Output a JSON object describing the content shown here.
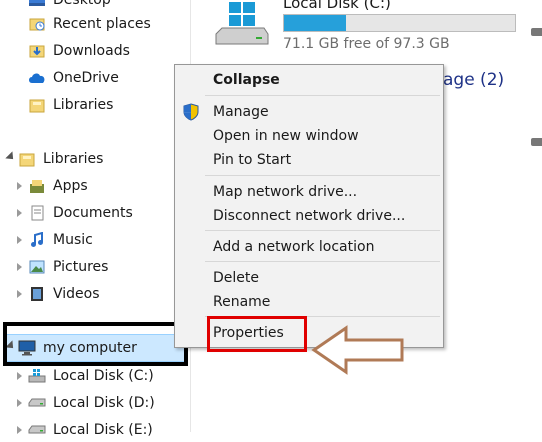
{
  "nav": {
    "quick_access": [
      "Desktop",
      "Recent places",
      "Downloads",
      "OneDrive",
      "Libraries"
    ],
    "libraries_label": "Libraries",
    "libraries": [
      "Apps",
      "Documents",
      "Music",
      "Pictures",
      "Videos"
    ],
    "computer_label": "my computer",
    "drives": [
      "Local Disk (C:)",
      "Local Disk (D:)",
      "Local Disk (E:)"
    ]
  },
  "content": {
    "disk_title": "Local Disk (C:)",
    "disk_free": "71.1 GB free of 97.3 GB",
    "disk_used_fraction": 0.27,
    "group_label": "rage (2)"
  },
  "context_menu": {
    "collapse": "Collapse",
    "manage": "Manage",
    "open_new_window": "Open in new window",
    "pin_to_start": "Pin to Start",
    "map_network_drive": "Map network drive...",
    "disconnect_network_drive": "Disconnect network drive...",
    "add_network_location": "Add a network location",
    "delete": "Delete",
    "rename": "Rename",
    "properties": "Properties"
  },
  "colors": {
    "selection": "#cce8ff",
    "highlight_box": "#e00000",
    "arrow_annotation": "#b07a56",
    "disk_fill": "#26a0da"
  }
}
